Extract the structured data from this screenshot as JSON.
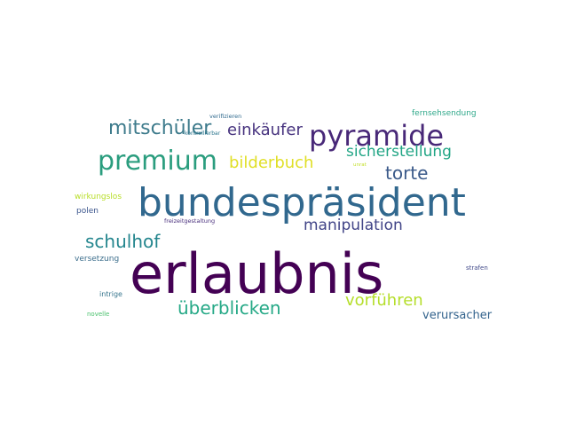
{
  "words": [
    {
      "text": "erlaubnis",
      "color": "#440154"
    },
    {
      "text": "bundespräsident",
      "color": "#31688e"
    },
    {
      "text": "pyramide",
      "color": "#482878"
    },
    {
      "text": "premium",
      "color": "#2a9d7e"
    },
    {
      "text": "mitschüler",
      "color": "#3e7b8c"
    },
    {
      "text": "einkäufer",
      "color": "#46327e"
    },
    {
      "text": "bilderbuch",
      "color": "#e0df26"
    },
    {
      "text": "sicherstellung",
      "color": "#21a585"
    },
    {
      "text": "torte",
      "color": "#3b5a8a"
    },
    {
      "text": "schulhof",
      "color": "#24868e"
    },
    {
      "text": "manipulation",
      "color": "#414487"
    },
    {
      "text": "überblicken",
      "color": "#26a987"
    },
    {
      "text": "vorführen",
      "color": "#b5de2b"
    },
    {
      "text": "verursacher",
      "color": "#33638d"
    },
    {
      "text": "fernsehsendung",
      "color": "#2ea88a"
    },
    {
      "text": "wirkungslos",
      "color": "#b8de29"
    },
    {
      "text": "polen",
      "color": "#3a548c"
    },
    {
      "text": "versetzung",
      "color": "#3c6e8c"
    },
    {
      "text": "intrige",
      "color": "#38768e"
    },
    {
      "text": "novelle",
      "color": "#4ac16d"
    },
    {
      "text": "strafen",
      "color": "#3f4788"
    },
    {
      "text": "freizeitgestaltung",
      "color": "#472d7b"
    },
    {
      "text": "verifizieren",
      "color": "#306a8e"
    },
    {
      "text": "kontrollierbar",
      "color": "#2b758e"
    },
    {
      "text": "unrat",
      "color": "#c2df23"
    }
  ]
}
